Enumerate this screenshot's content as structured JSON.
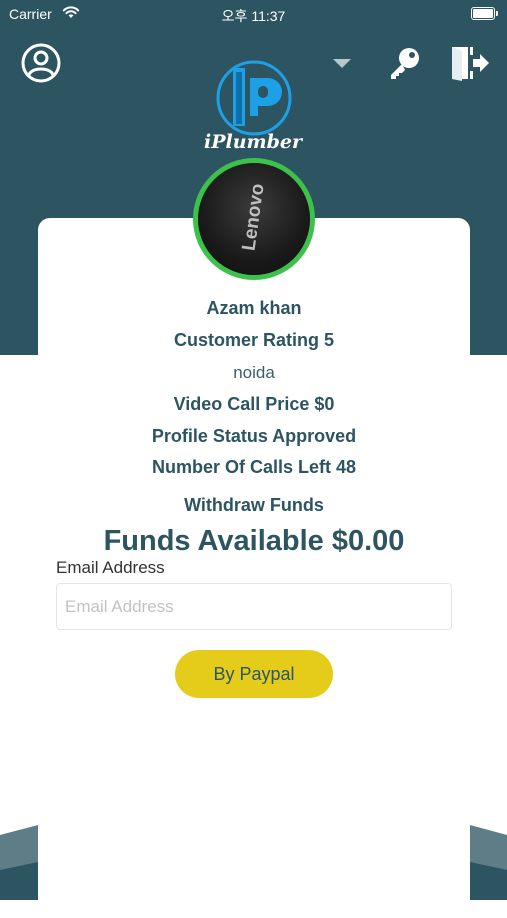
{
  "status_bar": {
    "carrier": "Carrier",
    "time": "오후 11:37"
  },
  "header": {
    "app_name": "iPlumber",
    "icons": [
      "user-circle-icon",
      "chevron-down-icon",
      "key-icon",
      "logout-icon"
    ]
  },
  "profile": {
    "avatar_text": "Lenovo",
    "name": "Azam khan",
    "customer_rating": "Customer Rating 5",
    "location": "noida",
    "video_call_price": "Video Call Price $0",
    "profile_status": "Profile Status Approved",
    "calls_left": "Number Of Calls Left 48"
  },
  "withdraw": {
    "title": "Withdraw Funds",
    "funds_available": "Funds Available $0.00",
    "email_label": "Email Address",
    "email_placeholder": "Email Address",
    "email_value": "",
    "paypal_button": "By Paypal"
  },
  "colors": {
    "header_bg": "#2d5561",
    "accent_green": "#3cc24a",
    "button_yellow": "#e6cc1a",
    "text_primary": "#2d5561",
    "logo_blue": "#1ea0e6"
  }
}
